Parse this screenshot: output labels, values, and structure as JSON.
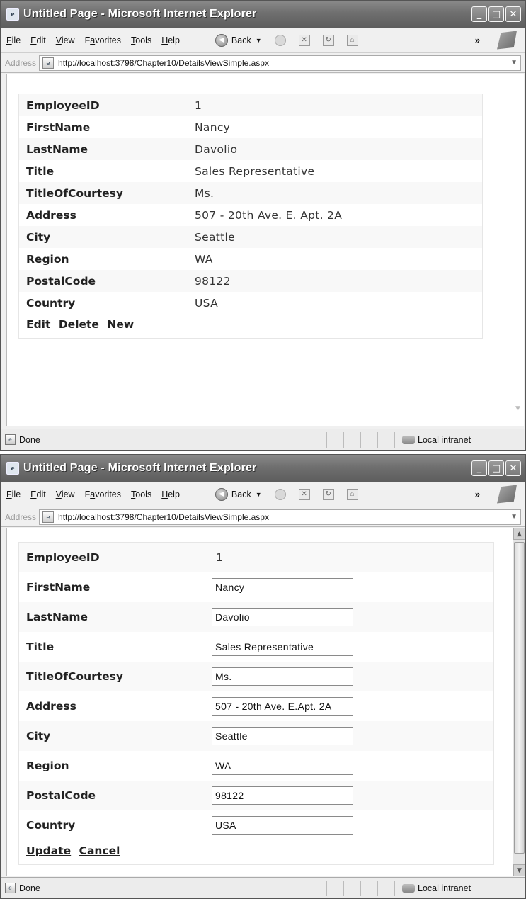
{
  "browser": {
    "title": "Untitled Page - Microsoft Internet Explorer",
    "menu": [
      {
        "pre": "",
        "ul": "F",
        "post": "ile"
      },
      {
        "pre": "",
        "ul": "E",
        "post": "dit"
      },
      {
        "pre": "",
        "ul": "V",
        "post": "iew"
      },
      {
        "pre": "F",
        "ul": "a",
        "post": "vorites"
      },
      {
        "pre": "",
        "ul": "T",
        "post": "ools"
      },
      {
        "pre": "",
        "ul": "H",
        "post": "elp"
      }
    ],
    "back_label": "Back",
    "chevron": "»",
    "address_label": "Address",
    "url": "http://localhost:3798/Chapter10/DetailsViewSimple.aspx",
    "status_text": "Done",
    "zone_text": "Local intranet"
  },
  "view_mode": {
    "fields": [
      {
        "label": "EmployeeID",
        "value": "1"
      },
      {
        "label": "FirstName",
        "value": "Nancy"
      },
      {
        "label": "LastName",
        "value": "Davolio"
      },
      {
        "label": "Title",
        "value": "Sales Representative"
      },
      {
        "label": "TitleOfCourtesy",
        "value": "Ms."
      },
      {
        "label": "Address",
        "value": "507 - 20th Ave. E. Apt. 2A"
      },
      {
        "label": "City",
        "value": "Seattle"
      },
      {
        "label": "Region",
        "value": "WA"
      },
      {
        "label": "PostalCode",
        "value": "98122"
      },
      {
        "label": "Country",
        "value": "USA"
      }
    ],
    "commands": {
      "edit": "Edit",
      "delete": "Delete",
      "new": "New"
    }
  },
  "edit_mode": {
    "fields": [
      {
        "label": "EmployeeID",
        "value": "1"
      },
      {
        "label": "FirstName",
        "value": "Nancy"
      },
      {
        "label": "LastName",
        "value": "Davolio"
      },
      {
        "label": "Title",
        "value": "Sales Representative"
      },
      {
        "label": "TitleOfCourtesy",
        "value": "Ms."
      },
      {
        "label": "Address",
        "value": "507 - 20th Ave. E.Apt. 2A"
      },
      {
        "label": "City",
        "value": "Seattle"
      },
      {
        "label": "Region",
        "value": "WA"
      },
      {
        "label": "PostalCode",
        "value": "98122"
      },
      {
        "label": "Country",
        "value": "USA"
      }
    ],
    "commands": {
      "update": "Update",
      "cancel": "Cancel"
    }
  }
}
